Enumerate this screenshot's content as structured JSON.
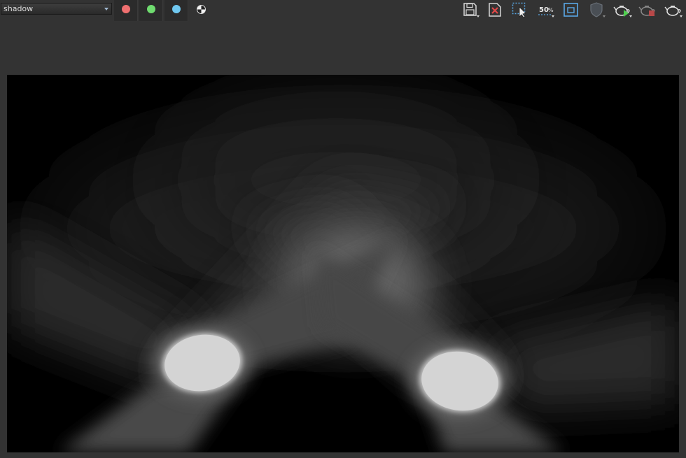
{
  "toolbar": {
    "layer_value": "shadow",
    "channels": [
      {
        "name": "red-channel",
        "color": "#f07070"
      },
      {
        "name": "green-channel",
        "color": "#6fdc6f"
      },
      {
        "name": "blue-channel",
        "color": "#70c8f0"
      }
    ],
    "snapshot_size": "50%",
    "icons": [
      "save-icon",
      "remove-image-icon",
      "region-select-icon",
      "snapshot-size-icon",
      "display-region-icon",
      "color-management-icon",
      "render-icon",
      "stop-render-icon",
      "ipr-render-icon"
    ]
  },
  "colors": {
    "background": "#333333",
    "viewport_bg": "#000000",
    "accent": "#5aa8e6"
  }
}
